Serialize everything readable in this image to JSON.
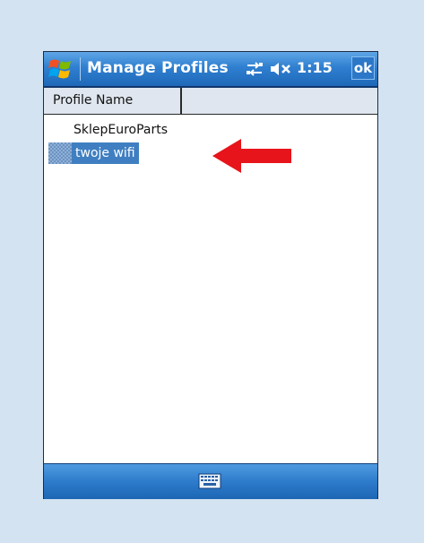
{
  "window": {
    "title": "Manage Profiles",
    "clock": "1:15",
    "ok_label": "ok",
    "icons": [
      "windows-start-icon",
      "connectivity-icon",
      "volume-muted-icon",
      "keyboard-icon"
    ]
  },
  "list": {
    "columns": [
      "Profile Name",
      ""
    ],
    "rows": [
      {
        "name": "SklepEuroParts",
        "selected": false
      },
      {
        "name": "twoje wifi",
        "selected": true
      }
    ]
  },
  "annotation": {
    "type": "arrow",
    "color": "#e8141b",
    "points_to": "twoje wifi"
  },
  "colors": {
    "titlebar": "#2f7fd0",
    "selection": "#3f7fc1",
    "background": "#d3e3f2"
  }
}
